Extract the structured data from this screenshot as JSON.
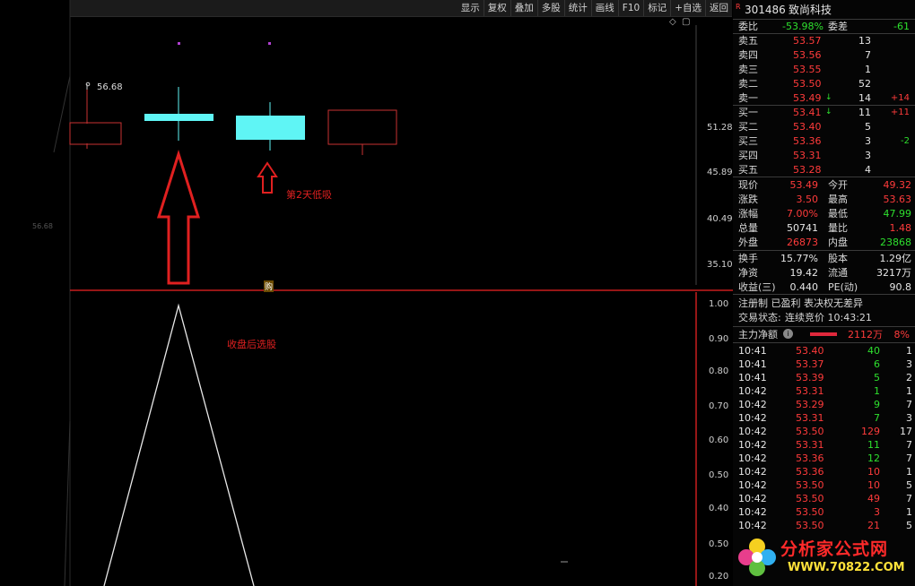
{
  "toolbar": {
    "items": [
      "显示",
      "复权",
      "叠加",
      "多股",
      "统计",
      "画线",
      "F10",
      "标记",
      "+自选",
      "返回"
    ]
  },
  "chart": {
    "high_label": "56.68",
    "left_faint_label": "56.68",
    "axis_upper": [
      "51.28",
      "45.89",
      "40.49",
      "35.10"
    ],
    "divider_label": "购",
    "axis_lower": [
      "1.00",
      "0.90",
      "0.80",
      "0.70",
      "0.60",
      "0.50",
      "0.40",
      "0.50",
      "0.20"
    ],
    "annotation_low": "第2天低吸",
    "annotation_pick": "收盘后选股",
    "icons_top": [
      "◇",
      "▢"
    ]
  },
  "stock": {
    "badge": "R",
    "code": "301486",
    "name": "致尚科技"
  },
  "weibi": {
    "label": "委比",
    "value": "-53.98%",
    "diff_label": "委差",
    "diff": "-61"
  },
  "asks": [
    {
      "label": "卖五",
      "price": "53.57",
      "vol": "13",
      "chg": ""
    },
    {
      "label": "卖四",
      "price": "53.56",
      "vol": "7",
      "chg": ""
    },
    {
      "label": "卖三",
      "price": "53.55",
      "vol": "1",
      "chg": ""
    },
    {
      "label": "卖二",
      "price": "53.50",
      "vol": "52",
      "chg": ""
    },
    {
      "label": "卖一",
      "price": "53.49",
      "vol": "14",
      "chg": "+14",
      "arrow": "↓"
    }
  ],
  "bids": [
    {
      "label": "买一",
      "price": "53.41",
      "vol": "11",
      "chg": "+11",
      "arrow": "↓"
    },
    {
      "label": "买二",
      "price": "53.40",
      "vol": "5",
      "chg": ""
    },
    {
      "label": "买三",
      "price": "53.36",
      "vol": "3",
      "chg": "-2"
    },
    {
      "label": "买四",
      "price": "53.31",
      "vol": "3",
      "chg": ""
    },
    {
      "label": "买五",
      "price": "53.28",
      "vol": "4",
      "chg": ""
    }
  ],
  "quote": [
    {
      "l1": "现价",
      "v1": "53.49",
      "l2": "今开",
      "v2": "49.32"
    },
    {
      "l1": "涨跌",
      "v1": "3.50",
      "l2": "最高",
      "v2": "53.63"
    },
    {
      "l1": "涨幅",
      "v1": "7.00%",
      "l2": "最低",
      "v2": "47.99"
    },
    {
      "l1": "总量",
      "v1": "50741",
      "l2": "量比",
      "v2": "1.48"
    },
    {
      "l1": "外盘",
      "v1": "26873",
      "l2": "内盘",
      "v2": "23868"
    }
  ],
  "fundamentals": [
    {
      "l1": "换手",
      "v1": "15.77%",
      "l2": "股本",
      "v2": "1.29亿"
    },
    {
      "l1": "净资",
      "v1": "19.42",
      "l2": "流通",
      "v2": "3217万"
    },
    {
      "l1": "收益(三)",
      "v1": "0.440",
      "l2": "PE(动)",
      "v2": "90.8"
    }
  ],
  "status": {
    "tags": "注册制 已盈利 表决权无差异",
    "trade_label": "交易状态:",
    "trade_value": "连续竞价 10:43:21",
    "flow_label": "主力净额",
    "flow_value": "2112万",
    "flow_pct": "8%"
  },
  "ticks": [
    {
      "t": "10:41",
      "p": "53.40",
      "v": "40",
      "n": "1",
      "vc": "green"
    },
    {
      "t": "10:41",
      "p": "53.37",
      "v": "6",
      "n": "3",
      "vc": "green"
    },
    {
      "t": "10:41",
      "p": "53.39",
      "v": "5",
      "n": "2",
      "vc": "green"
    },
    {
      "t": "10:42",
      "p": "53.31",
      "v": "1",
      "n": "1",
      "vc": "green"
    },
    {
      "t": "10:42",
      "p": "53.29",
      "v": "9",
      "n": "7",
      "vc": "green"
    },
    {
      "t": "10:42",
      "p": "53.31",
      "v": "7",
      "n": "3",
      "vc": "green"
    },
    {
      "t": "10:42",
      "p": "53.50",
      "v": "129",
      "n": "17",
      "vc": "red"
    },
    {
      "t": "10:42",
      "p": "53.31",
      "v": "11",
      "n": "7",
      "vc": "green"
    },
    {
      "t": "10:42",
      "p": "53.36",
      "v": "12",
      "n": "7",
      "vc": "green"
    },
    {
      "t": "10:42",
      "p": "53.36",
      "v": "10",
      "n": "1",
      "vc": "red"
    },
    {
      "t": "10:42",
      "p": "53.50",
      "v": "10",
      "n": "5",
      "vc": "red"
    },
    {
      "t": "10:42",
      "p": "53.50",
      "v": "49",
      "n": "7",
      "vc": "red"
    },
    {
      "t": "10:42",
      "p": "53.50",
      "v": "3",
      "n": "1",
      "vc": "red"
    },
    {
      "t": "10:42",
      "p": "53.50",
      "v": "21",
      "n": "5",
      "vc": "red"
    }
  ],
  "watermark": {
    "title": "分析家公式网",
    "url": "WWW.70822.COM"
  },
  "colors": {
    "up": "#ff3b3b",
    "down": "#2ee02e",
    "cyan": "#5ff5f5",
    "divider": "#c81e1e"
  }
}
